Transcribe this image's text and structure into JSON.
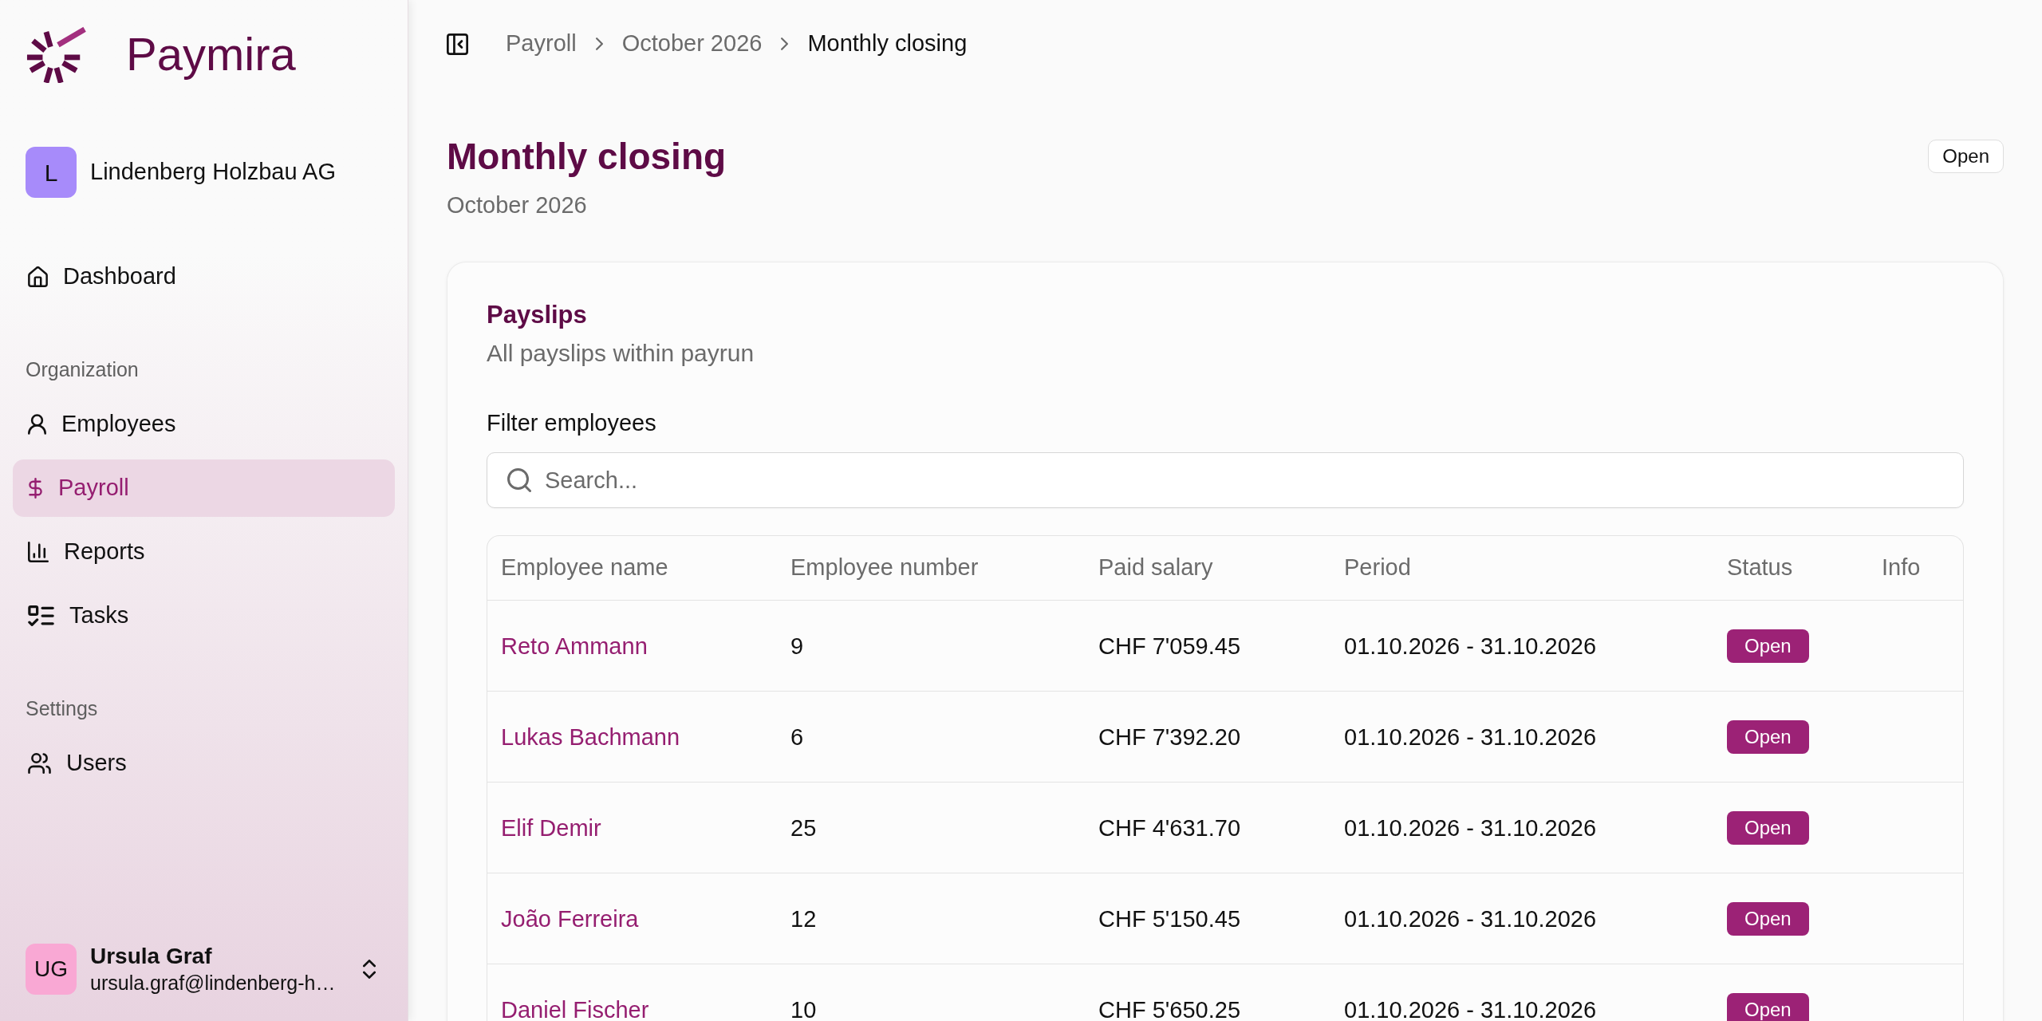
{
  "sidebar": {
    "logo": {
      "text": "Paymira"
    },
    "organization": {
      "initial": "L",
      "name": "Lindenberg Holzbau AG"
    },
    "groups": [
      {
        "items": [
          {
            "label": "Dashboard",
            "selected": false
          }
        ]
      },
      {
        "heading": "Organization",
        "items": [
          {
            "label": "Employees",
            "selected": false
          },
          {
            "label": "Payroll",
            "selected": true
          },
          {
            "label": "Reports",
            "selected": false
          },
          {
            "label": "Tasks",
            "selected": false
          }
        ]
      },
      {
        "heading": "Settings",
        "items": [
          {
            "label": "Users",
            "selected": false
          }
        ]
      }
    ],
    "user": {
      "initials": "UG",
      "name": "Ursula Graf",
      "email": "ursula.graf@lindenberg-h…"
    }
  },
  "breadcrumb": [
    {
      "label": "Payroll",
      "current": false
    },
    {
      "label": "October 2026",
      "current": false
    },
    {
      "label": "Monthly closing",
      "current": true
    }
  ],
  "header": {
    "title": "Monthly closing",
    "subtitle": "October 2026",
    "status": "Open"
  },
  "payslips": {
    "title": "Payslips",
    "description": "All payslips within payrun",
    "filter_label": "Filter employees",
    "search": {
      "placeholder": "Search..."
    },
    "table": {
      "columns": [
        "Employee name",
        "Employee number",
        "Paid salary",
        "Period",
        "Status",
        "Info"
      ],
      "rows": [
        {
          "name": "Reto Ammann",
          "number": "9",
          "salary": "CHF 7'059.45",
          "period": "01.10.2026 - 31.10.2026",
          "status": "Open"
        },
        {
          "name": "Lukas Bachmann",
          "number": "6",
          "salary": "CHF 7'392.20",
          "period": "01.10.2026 - 31.10.2026",
          "status": "Open"
        },
        {
          "name": "Elif Demir",
          "number": "25",
          "salary": "CHF 4'631.70",
          "period": "01.10.2026 - 31.10.2026",
          "status": "Open"
        },
        {
          "name": "João Ferreira",
          "number": "12",
          "salary": "CHF 5'150.45",
          "period": "01.10.2026 - 31.10.2026",
          "status": "Open"
        },
        {
          "name": "Daniel Fischer",
          "number": "10",
          "salary": "CHF 5'650.25",
          "period": "01.10.2026 - 31.10.2026",
          "status": "Open"
        }
      ]
    }
  }
}
